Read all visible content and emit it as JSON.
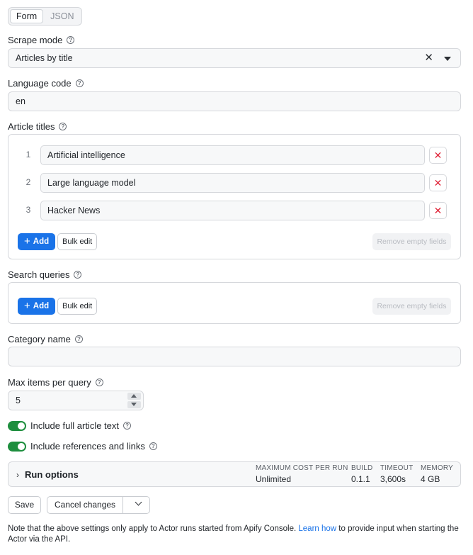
{
  "tabs": {
    "form": "Form",
    "json": "JSON"
  },
  "scrape_mode": {
    "label": "Scrape mode",
    "value": "Articles by title",
    "clear": "✕"
  },
  "language_code": {
    "label": "Language code",
    "value": "en"
  },
  "article_titles": {
    "label": "Article titles",
    "items": [
      {
        "num": "1",
        "value": "Artificial intelligence"
      },
      {
        "num": "2",
        "value": "Large language model"
      },
      {
        "num": "3",
        "value": "Hacker News"
      }
    ],
    "add": "Add",
    "bulk": "Bulk edit",
    "remove": "Remove empty fields"
  },
  "search_queries": {
    "label": "Search queries",
    "add": "Add",
    "bulk": "Bulk edit",
    "remove": "Remove empty fields"
  },
  "category_name": {
    "label": "Category name",
    "value": ""
  },
  "max_items": {
    "label": "Max items per query",
    "value": "5"
  },
  "toggles": {
    "full_text": {
      "label": "Include full article text",
      "on": true
    },
    "refs": {
      "label": "Include references and links",
      "on": true
    }
  },
  "run_options": {
    "title": "Run options",
    "cols": [
      {
        "h": "MAXIMUM COST PER RUN",
        "v": "Unlimited"
      },
      {
        "h": "BUILD",
        "v": "0.1.1"
      },
      {
        "h": "TIMEOUT",
        "v": "3,600s"
      },
      {
        "h": "MEMORY",
        "v": "4 GB"
      }
    ]
  },
  "actions": {
    "save": "Save",
    "cancel": "Cancel changes"
  },
  "note": {
    "before": "Note that the above settings only apply to Actor runs started from Apify Console. ",
    "link": "Learn how",
    "after": " to provide input when starting the Actor via the API."
  },
  "colors": {
    "accent": "#1a73e8",
    "toggle_on": "#1e8e3e",
    "danger": "#e0263a"
  }
}
